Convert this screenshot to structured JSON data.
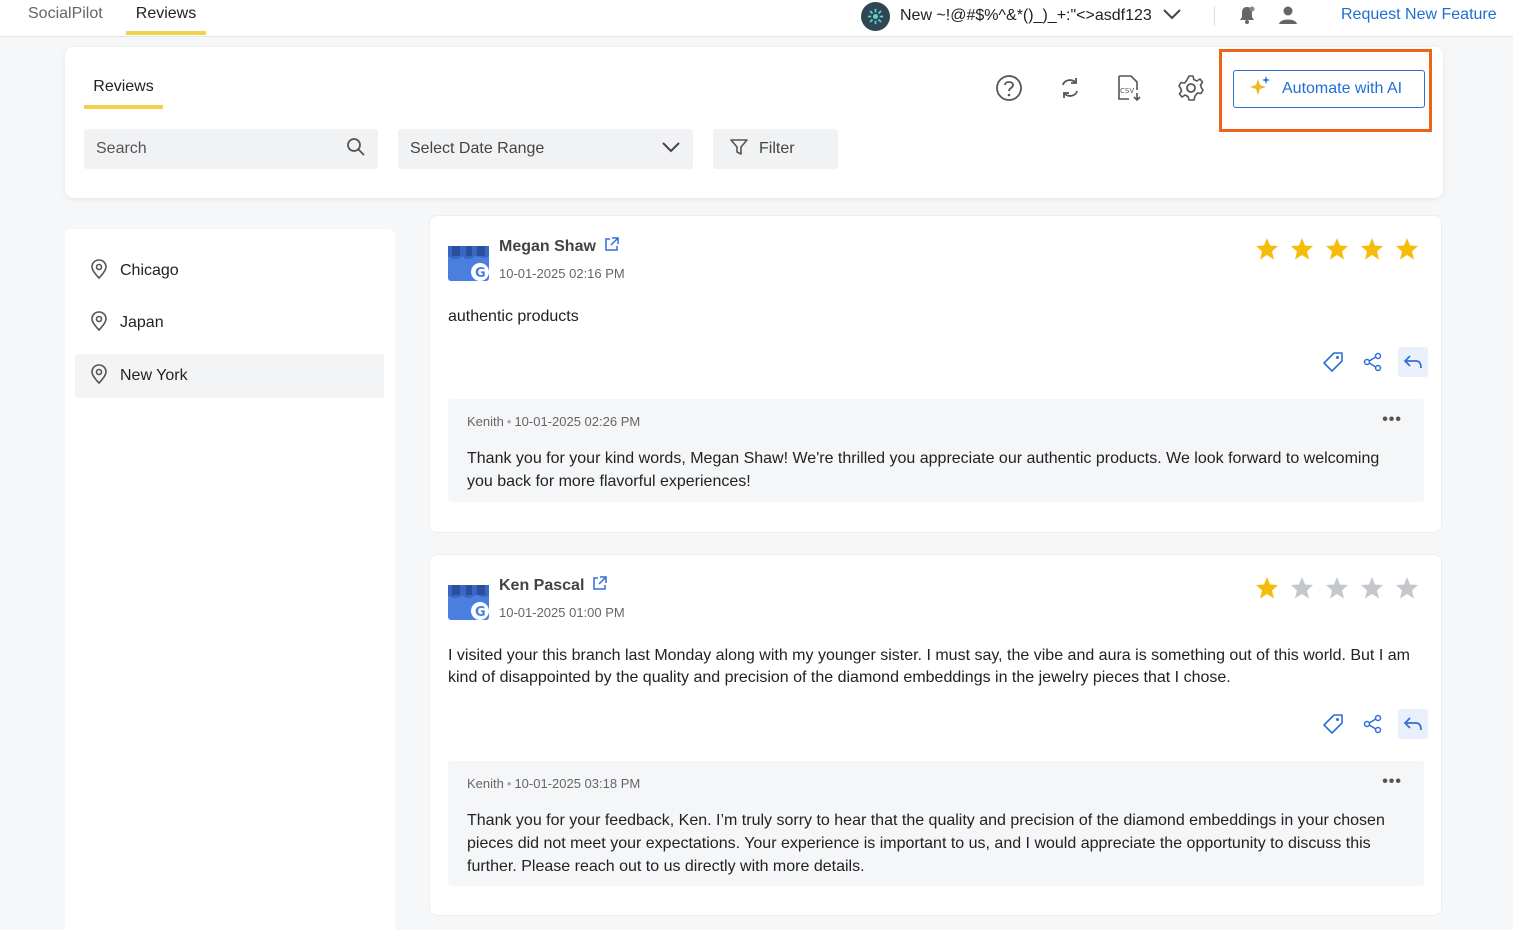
{
  "topnav": {
    "tabs": [
      {
        "label": "SocialPilot"
      },
      {
        "label": "Reviews"
      }
    ],
    "workspace_name": "New ~!@#$%^&*()_)_+:\"<>asdf123",
    "request_feature_label": "Request New Feature"
  },
  "header": {
    "subtab_label": "Reviews",
    "automate_label": "Automate with AI",
    "search_placeholder": "Search",
    "date_range_label": "Select Date Range",
    "filter_label": "Filter"
  },
  "sidebar": {
    "locations": [
      {
        "label": "Chicago"
      },
      {
        "label": "Japan"
      },
      {
        "label": "New York"
      }
    ]
  },
  "reviews": [
    {
      "reviewer": "Megan Shaw",
      "date": "10-01-2025 02:16 PM",
      "rating": 5,
      "text": "authentic products",
      "reply": {
        "author": "Kenith",
        "date": "10-01-2025 02:26 PM",
        "text": "Thank you for your kind words, Megan Shaw! We're thrilled you appreciate our authentic products. We look forward to welcoming you back for more flavorful experiences!"
      }
    },
    {
      "reviewer": "Ken Pascal",
      "date": "10-01-2025 01:00 PM",
      "rating": 1,
      "text": "I visited your this branch last Monday along with my younger sister. I must say, the vibe and aura is something out of this world. But I am kind of disappointed by the quality and precision of the diamond embeddings in the jewelry pieces that I chose.",
      "reply": {
        "author": "Kenith",
        "date": "10-01-2025 03:18 PM",
        "text": "Thank you for your feedback, Ken. I’m truly sorry to hear that the quality and precision of the diamond embeddings in your chosen pieces did not meet your expectations. Your experience is important to us, and I would appreciate the opportunity to discuss this further. Please reach out to us directly with more details."
      }
    }
  ],
  "colors": {
    "accent_blue": "#1f6fd1",
    "highlight_orange": "#ee6416",
    "tab_underline": "#f2d24a",
    "star_filled": "#f5bd0b",
    "star_empty": "#c4c7cc"
  },
  "icons": [
    "workspace-icon",
    "chevron-down-icon",
    "bell-icon",
    "user-icon",
    "help-icon",
    "refresh-icon",
    "csv-export-icon",
    "gear-icon",
    "sparkle-icon",
    "search-icon",
    "filter-icon",
    "location-pin-icon",
    "external-link-icon",
    "star-icon",
    "tag-icon",
    "share-icon",
    "reply-icon",
    "more-icon"
  ]
}
